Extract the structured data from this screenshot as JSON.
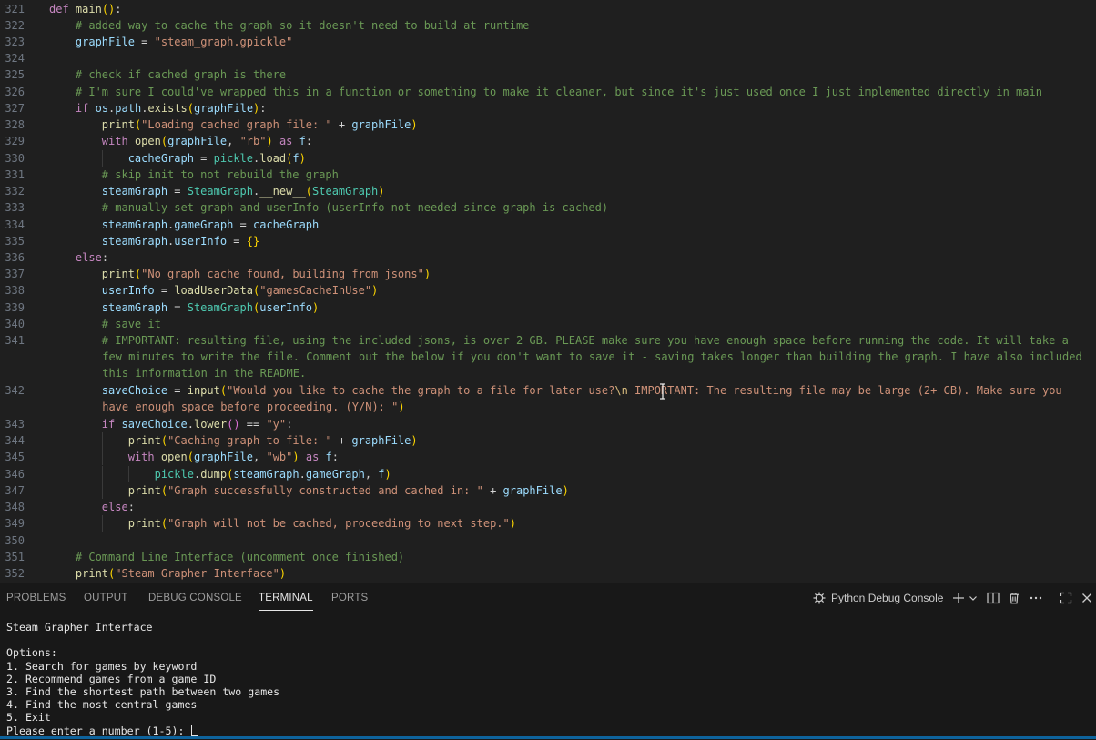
{
  "editor": {
    "lines": [
      {
        "n": "321",
        "segs": [
          [
            "kw",
            "def"
          ],
          [
            "p",
            " "
          ],
          [
            "fn",
            "main"
          ],
          [
            "br",
            "()"
          ],
          [
            "p",
            ":"
          ]
        ]
      },
      {
        "n": "322",
        "segs": [
          [
            "p",
            "    "
          ],
          [
            "com",
            "# added way to cache the graph so it doesn't need to build at runtime"
          ]
        ]
      },
      {
        "n": "323",
        "segs": [
          [
            "p",
            "    "
          ],
          [
            "var",
            "graphFile"
          ],
          [
            "op",
            " = "
          ],
          [
            "str",
            "\"steam_graph.gpickle\""
          ]
        ]
      },
      {
        "n": "324",
        "segs": []
      },
      {
        "n": "325",
        "segs": [
          [
            "p",
            "    "
          ],
          [
            "com",
            "# check if cached graph is there"
          ]
        ]
      },
      {
        "n": "326",
        "segs": [
          [
            "p",
            "    "
          ],
          [
            "com",
            "# I'm sure I could've wrapped this in a function or something to make it cleaner, but since it's just used once I just implemented directly in main"
          ]
        ]
      },
      {
        "n": "327",
        "segs": [
          [
            "p",
            "    "
          ],
          [
            "kw",
            "if"
          ],
          [
            "p",
            " "
          ],
          [
            "var",
            "os"
          ],
          [
            "p",
            "."
          ],
          [
            "var",
            "path"
          ],
          [
            "p",
            "."
          ],
          [
            "fn",
            "exists"
          ],
          [
            "br",
            "("
          ],
          [
            "var",
            "graphFile"
          ],
          [
            "br",
            ")"
          ],
          [
            "p",
            ":"
          ]
        ]
      },
      {
        "n": "328",
        "segs": [
          [
            "p",
            "        "
          ],
          [
            "fn",
            "print"
          ],
          [
            "br",
            "("
          ],
          [
            "str",
            "\"Loading cached graph file: \""
          ],
          [
            "op",
            " + "
          ],
          [
            "var",
            "graphFile"
          ],
          [
            "br",
            ")"
          ]
        ]
      },
      {
        "n": "329",
        "segs": [
          [
            "p",
            "        "
          ],
          [
            "kw",
            "with"
          ],
          [
            "p",
            " "
          ],
          [
            "fn",
            "open"
          ],
          [
            "br",
            "("
          ],
          [
            "var",
            "graphFile"
          ],
          [
            "p",
            ", "
          ],
          [
            "str",
            "\"rb\""
          ],
          [
            "br",
            ")"
          ],
          [
            "p",
            " "
          ],
          [
            "kw",
            "as"
          ],
          [
            "p",
            " "
          ],
          [
            "var",
            "f"
          ],
          [
            "p",
            ":"
          ]
        ]
      },
      {
        "n": "330",
        "segs": [
          [
            "p",
            "            "
          ],
          [
            "var",
            "cacheGraph"
          ],
          [
            "op",
            " = "
          ],
          [
            "cls",
            "pickle"
          ],
          [
            "p",
            "."
          ],
          [
            "fn",
            "load"
          ],
          [
            "br",
            "("
          ],
          [
            "var",
            "f"
          ],
          [
            "br",
            ")"
          ]
        ]
      },
      {
        "n": "331",
        "segs": [
          [
            "p",
            "        "
          ],
          [
            "com",
            "# skip init to not rebuild the graph"
          ]
        ]
      },
      {
        "n": "332",
        "segs": [
          [
            "p",
            "        "
          ],
          [
            "var",
            "steamGraph"
          ],
          [
            "op",
            " = "
          ],
          [
            "cls",
            "SteamGraph"
          ],
          [
            "p",
            "."
          ],
          [
            "fn",
            "__new__"
          ],
          [
            "br",
            "("
          ],
          [
            "cls",
            "SteamGraph"
          ],
          [
            "br",
            ")"
          ]
        ]
      },
      {
        "n": "333",
        "segs": [
          [
            "p",
            "        "
          ],
          [
            "com",
            "# manually set graph and userInfo (userInfo not needed since graph is cached)"
          ]
        ]
      },
      {
        "n": "334",
        "segs": [
          [
            "p",
            "        "
          ],
          [
            "var",
            "steamGraph"
          ],
          [
            "p",
            "."
          ],
          [
            "var",
            "gameGraph"
          ],
          [
            "op",
            " = "
          ],
          [
            "var",
            "cacheGraph"
          ]
        ]
      },
      {
        "n": "335",
        "segs": [
          [
            "p",
            "        "
          ],
          [
            "var",
            "steamGraph"
          ],
          [
            "p",
            "."
          ],
          [
            "var",
            "userInfo"
          ],
          [
            "op",
            " = "
          ],
          [
            "br",
            "{}"
          ]
        ]
      },
      {
        "n": "336",
        "segs": [
          [
            "p",
            "    "
          ],
          [
            "kw",
            "else"
          ],
          [
            "p",
            ":"
          ]
        ]
      },
      {
        "n": "337",
        "segs": [
          [
            "p",
            "        "
          ],
          [
            "fn",
            "print"
          ],
          [
            "br",
            "("
          ],
          [
            "str",
            "\"No graph cache found, building from jsons\""
          ],
          [
            "br",
            ")"
          ]
        ]
      },
      {
        "n": "338",
        "segs": [
          [
            "p",
            "        "
          ],
          [
            "var",
            "userInfo"
          ],
          [
            "op",
            " = "
          ],
          [
            "fn",
            "loadUserData"
          ],
          [
            "br",
            "("
          ],
          [
            "str",
            "\"gamesCacheInUse\""
          ],
          [
            "br",
            ")"
          ]
        ]
      },
      {
        "n": "339",
        "segs": [
          [
            "p",
            "        "
          ],
          [
            "var",
            "steamGraph"
          ],
          [
            "op",
            " = "
          ],
          [
            "cls",
            "SteamGraph"
          ],
          [
            "br",
            "("
          ],
          [
            "var",
            "userInfo"
          ],
          [
            "br",
            ")"
          ]
        ]
      },
      {
        "n": "340",
        "segs": [
          [
            "p",
            "        "
          ],
          [
            "com",
            "# save it"
          ]
        ]
      },
      {
        "n": "341",
        "segs": [
          [
            "p",
            "        "
          ],
          [
            "com",
            "# IMPORTANT: resulting file, using the included jsons, is over 2 GB. PLEASE make sure you have enough space before running the code. It will take a few minutes to write the file. Comment out the below if you don't want to save it - saving takes longer than building the graph. I have also included this information in the README."
          ]
        ]
      },
      {
        "n": "342",
        "segs": [
          [
            "p",
            "        "
          ],
          [
            "var",
            "saveChoice"
          ],
          [
            "op",
            " = "
          ],
          [
            "fn",
            "input"
          ],
          [
            "br",
            "("
          ],
          [
            "str",
            "\"Would you like to cache the graph to a file for later use?"
          ],
          [
            "esc",
            "\\n"
          ],
          [
            "str",
            " IMPORTANT: The resulting file may be large (2+ GB). Make sure you have enough space before proceeding. (Y/N): \""
          ],
          [
            "br",
            ")"
          ]
        ]
      },
      {
        "n": "343",
        "segs": [
          [
            "p",
            "        "
          ],
          [
            "kw",
            "if"
          ],
          [
            "p",
            " "
          ],
          [
            "var",
            "saveChoice"
          ],
          [
            "p",
            "."
          ],
          [
            "fn",
            "lower"
          ],
          [
            "br2",
            "()"
          ],
          [
            "op",
            " == "
          ],
          [
            "str",
            "\"y\""
          ],
          [
            "p",
            ":"
          ]
        ]
      },
      {
        "n": "344",
        "segs": [
          [
            "p",
            "            "
          ],
          [
            "fn",
            "print"
          ],
          [
            "br",
            "("
          ],
          [
            "str",
            "\"Caching graph to file: \""
          ],
          [
            "op",
            " + "
          ],
          [
            "var",
            "graphFile"
          ],
          [
            "br",
            ")"
          ]
        ]
      },
      {
        "n": "345",
        "segs": [
          [
            "p",
            "            "
          ],
          [
            "kw",
            "with"
          ],
          [
            "p",
            " "
          ],
          [
            "fn",
            "open"
          ],
          [
            "br",
            "("
          ],
          [
            "var",
            "graphFile"
          ],
          [
            "p",
            ", "
          ],
          [
            "str",
            "\"wb\""
          ],
          [
            "br",
            ")"
          ],
          [
            "p",
            " "
          ],
          [
            "kw",
            "as"
          ],
          [
            "p",
            " "
          ],
          [
            "var",
            "f"
          ],
          [
            "p",
            ":"
          ]
        ]
      },
      {
        "n": "346",
        "segs": [
          [
            "p",
            "                "
          ],
          [
            "cls",
            "pickle"
          ],
          [
            "p",
            "."
          ],
          [
            "fn",
            "dump"
          ],
          [
            "br",
            "("
          ],
          [
            "var",
            "steamGraph"
          ],
          [
            "p",
            "."
          ],
          [
            "var",
            "gameGraph"
          ],
          [
            "p",
            ", "
          ],
          [
            "var",
            "f"
          ],
          [
            "br",
            ")"
          ]
        ]
      },
      {
        "n": "347",
        "segs": [
          [
            "p",
            "            "
          ],
          [
            "fn",
            "print"
          ],
          [
            "br",
            "("
          ],
          [
            "str",
            "\"Graph successfully constructed and cached in: \""
          ],
          [
            "op",
            " + "
          ],
          [
            "var",
            "graphFile"
          ],
          [
            "br",
            ")"
          ]
        ]
      },
      {
        "n": "348",
        "segs": [
          [
            "p",
            "        "
          ],
          [
            "kw",
            "else"
          ],
          [
            "p",
            ":"
          ]
        ]
      },
      {
        "n": "349",
        "segs": [
          [
            "p",
            "            "
          ],
          [
            "fn",
            "print"
          ],
          [
            "br",
            "("
          ],
          [
            "str",
            "\"Graph will not be cached, proceeding to next step.\""
          ],
          [
            "br",
            ")"
          ]
        ]
      },
      {
        "n": "350",
        "segs": []
      },
      {
        "n": "351",
        "segs": [
          [
            "p",
            "    "
          ],
          [
            "com",
            "# Command Line Interface (uncomment once finished)"
          ]
        ]
      },
      {
        "n": "352",
        "segs": [
          [
            "p",
            "    "
          ],
          [
            "fn",
            "print"
          ],
          [
            "br",
            "("
          ],
          [
            "str",
            "\"Steam Grapher Interface\""
          ],
          [
            "br",
            ")"
          ]
        ]
      }
    ]
  },
  "panel": {
    "tabs": [
      {
        "id": "problems",
        "label": "PROBLEMS",
        "active": false
      },
      {
        "id": "output",
        "label": "OUTPUT",
        "active": false
      },
      {
        "id": "debug-console",
        "label": "DEBUG CONSOLE",
        "active": false
      },
      {
        "id": "terminal",
        "label": "TERMINAL",
        "active": true
      },
      {
        "id": "ports",
        "label": "PORTS",
        "active": false
      }
    ],
    "console_name": "Python Debug Console",
    "terminal_lines": [
      "Steam Grapher Interface",
      "",
      "Options:",
      "1. Search for games by keyword",
      "2. Recommend games from a game ID",
      "3. Find the shortest path between two games",
      "4. Find the most central games",
      "5. Exit"
    ],
    "prompt": "Please enter a number (1-5): "
  },
  "colors": {
    "editor_bg": "#1f1f1f",
    "panel_bg": "#181818",
    "keyword": "#c586c0",
    "function": "#dcdcaa",
    "variable": "#9cdcfe",
    "class": "#4ec9b0",
    "string": "#ce9178",
    "comment": "#6a9955",
    "accent": "#0e639c"
  }
}
